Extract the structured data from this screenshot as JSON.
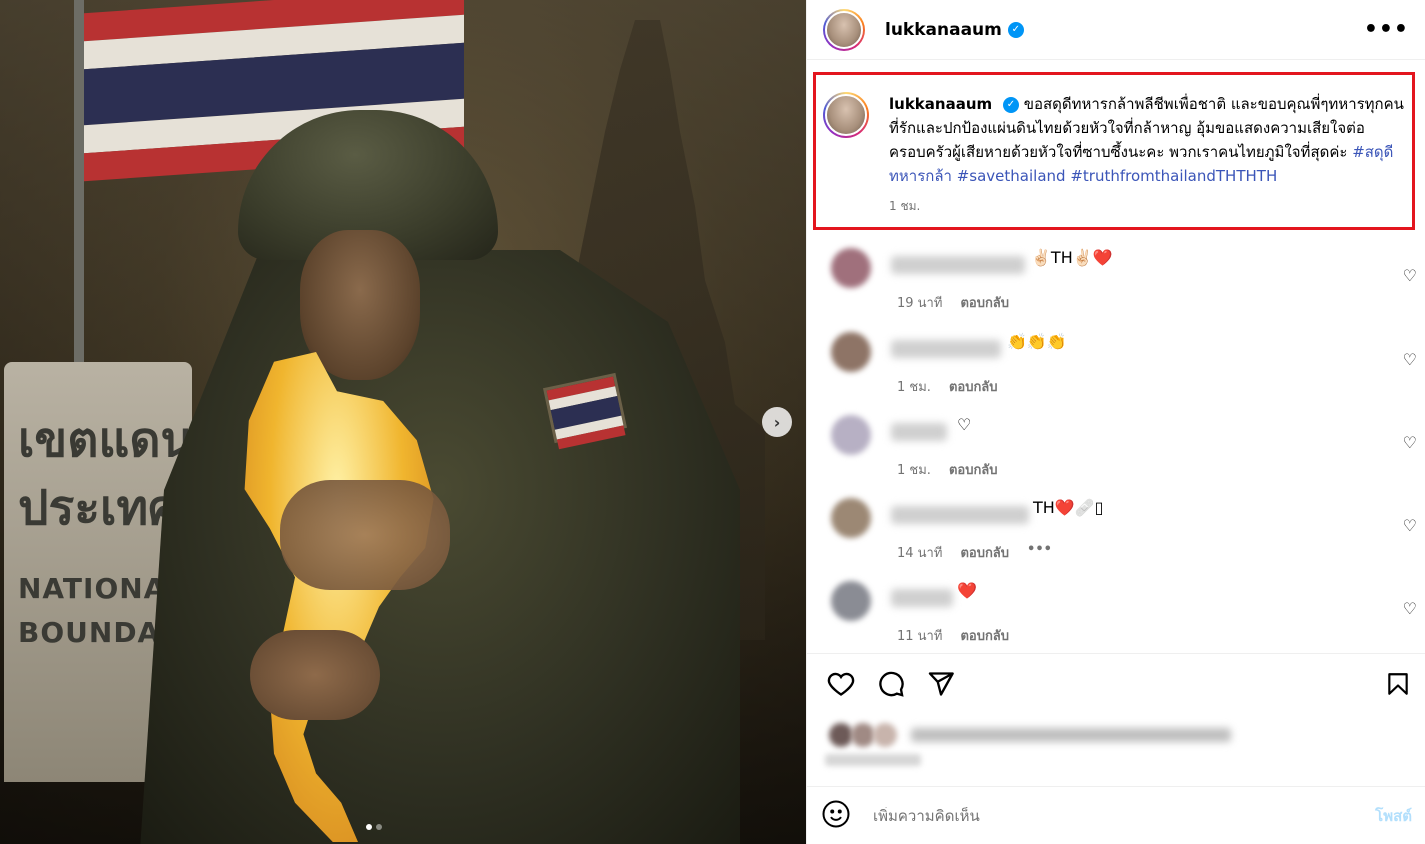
{
  "post": {
    "username": "lukkanaaum",
    "more_icon": "more-horizontal-icon",
    "image_alt_sign": {
      "line1": "เขตแดน",
      "line2": "ประเทศ",
      "line3": "NATIONA",
      "line4": "BOUNDARY"
    },
    "carousel": {
      "next_label": "›",
      "total": 2,
      "current": 1
    }
  },
  "caption": {
    "username": "lukkanaaum",
    "text": "ขอสดุดีทหารกล้าพลีชีพเพื่อชาติ และขอบคุณพี่ๆทหารทุกคนที่รักและปกป้องแผ่นดินไทยด้วยหัวใจที่กล้าหาญ อุ้มขอแสดงความเสียใจต่อครอบครัวผู้เสียหายด้วยหัวใจที่ซาบซึ้งนะคะ พวกเราคนไทยภูมิใจที่สุดค่ะ ",
    "tag1": "#สดุดีทหารกล้า",
    "tag2": "#savethailand",
    "tag3": "#truthfromthailandTHTHTH",
    "time": "1 ชม."
  },
  "comments": [
    {
      "text": "✌🏻TH✌🏻❤️",
      "time": "19 นาที",
      "reply": "ตอบกลับ"
    },
    {
      "text": "👏👏👏",
      "time": "1 ชม.",
      "reply": "ตอบกลับ"
    },
    {
      "text": "♡",
      "time": "1 ชม.",
      "reply": "ตอบกลับ"
    },
    {
      "text": "TH❤️🩹▯",
      "time": "14 นาที",
      "reply": "ตอบกลับ",
      "more": "•••"
    },
    {
      "text": "❤️",
      "time": "11 นาที",
      "reply": "ตอบกลับ"
    }
  ],
  "actions": {
    "like_icon": "heart-icon",
    "comment_icon": "comment-icon",
    "share_icon": "send-icon",
    "save_icon": "bookmark-icon"
  },
  "add_comment": {
    "emoji_icon": "emoji-icon",
    "placeholder": "เพิ่มความคิดเห็น",
    "post_label": "โพสต์"
  },
  "colors": {
    "verified": "#0095f6",
    "highlight_box": "#e3161e",
    "hashtag": "#3b55b8",
    "post_button_disabled": "#b2dffc"
  }
}
